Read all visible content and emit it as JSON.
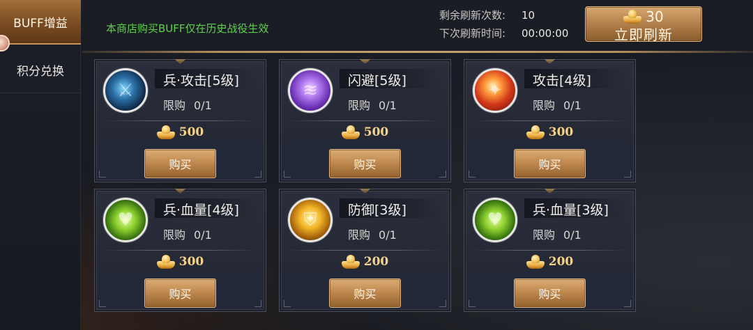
{
  "sidebar": {
    "tabs": [
      {
        "label": "BUFF增益",
        "active": true
      },
      {
        "label": "积分兑换",
        "active": false
      }
    ]
  },
  "header": {
    "notice": "本商店购买BUFF仅在历史战役生效",
    "refresh_count_label": "剩余刷新次数:",
    "refresh_count_value": "10",
    "next_refresh_label": "下次刷新时间:",
    "next_refresh_value": "00:00:00",
    "refresh_button": {
      "cost": "30",
      "label": "立即刷新"
    }
  },
  "shop": {
    "items": [
      {
        "name": "兵·攻击[5级]",
        "limit_label": "限购",
        "limit_value": "0/1",
        "price": "500",
        "buy_label": "购买",
        "icon": "troop-attack-icon"
      },
      {
        "name": "闪避[5级]",
        "limit_label": "限购",
        "limit_value": "0/1",
        "price": "500",
        "buy_label": "购买",
        "icon": "dodge-icon"
      },
      {
        "name": "攻击[4级]",
        "limit_label": "限购",
        "limit_value": "0/1",
        "price": "300",
        "buy_label": "购买",
        "icon": "attack-icon"
      },
      {
        "name": "兵·血量[4级]",
        "limit_label": "限购",
        "limit_value": "0/1",
        "price": "300",
        "buy_label": "购买",
        "icon": "troop-hp-icon"
      },
      {
        "name": "防御[3级]",
        "limit_label": "限购",
        "limit_value": "0/1",
        "price": "200",
        "buy_label": "购买",
        "icon": "defense-icon"
      },
      {
        "name": "兵·血量[3级]",
        "limit_label": "限购",
        "limit_value": "0/1",
        "price": "200",
        "buy_label": "购买",
        "icon": "troop-hp-icon"
      }
    ]
  },
  "colors": {
    "notice_green": "#5fd24b",
    "gold_button": "#c08a50",
    "price_gold": "#f4d28a"
  }
}
